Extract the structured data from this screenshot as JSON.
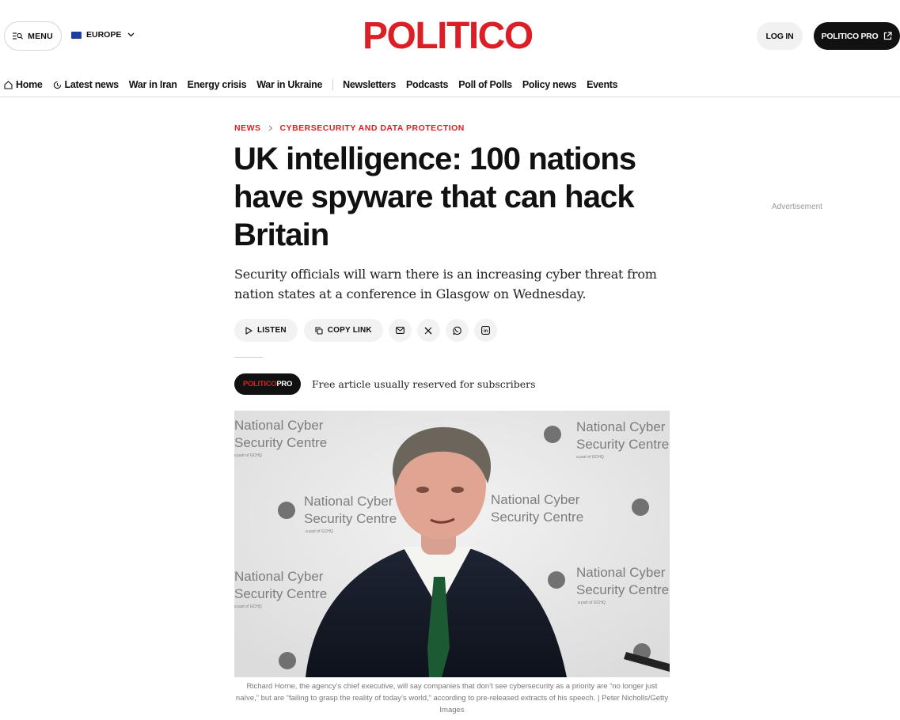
{
  "header": {
    "menu_label": "MENU",
    "edition_label": "EUROPE",
    "logo_text": "POLITICO",
    "login_label": "LOG IN",
    "pro_label": "POLITICO PRO",
    "brand_color": "#dc1f26"
  },
  "nav": {
    "items": [
      {
        "label": "Home",
        "icon": "home-icon"
      },
      {
        "label": "Latest news",
        "icon": "clock-icon"
      },
      {
        "label": "War in Iran"
      },
      {
        "label": "Energy crisis"
      },
      {
        "label": "War in Ukraine"
      },
      {
        "label": "Newsletters"
      },
      {
        "label": "Podcasts"
      },
      {
        "label": "Poll of Polls"
      },
      {
        "label": "Policy news"
      },
      {
        "label": "Events"
      }
    ]
  },
  "article": {
    "breadcrumb": [
      "NEWS",
      "CYBERSECURITY AND DATA PROTECTION"
    ],
    "headline": "UK intelligence: 100 nations have spyware that can hack Britain",
    "dek": "Security officials will warn there is an increasing cyber threat from nation states at a conference in Glasgow on Wednesday.",
    "listen_label": "LISTEN",
    "copy_link_label": "COPY LINK",
    "share_icons": [
      "email-icon",
      "x-icon",
      "whatsapp-icon",
      "linkedin-icon"
    ],
    "pro_badge_part1": "POLITICO",
    "pro_badge_part2": "PRO",
    "pro_note": "Free article usually reserved for subscribers",
    "caption": "Richard Horne, the agency’s chief executive, will say companies that don’t see cybersecurity as a priority are “no longer just naïve,” but are “failing to grasp the reality of today’s world,” according to pre-released extracts of his speech. | Peter Nicholls/Getty Images",
    "backdrop_text": [
      "National Cyber",
      "Security Centre",
      "a part of GCHQ"
    ]
  },
  "sidebar": {
    "ad_label": "Advertisement"
  }
}
